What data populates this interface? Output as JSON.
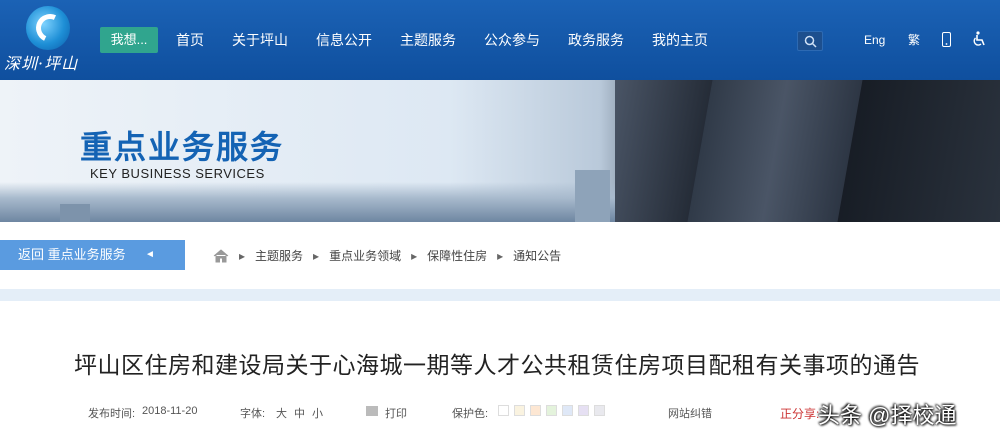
{
  "header": {
    "logo_text": "深圳·坪山",
    "wish_label": "我想...",
    "nav": [
      "首页",
      "关于坪山",
      "信息公开",
      "主题服务",
      "公众参与",
      "政务服务",
      "我的主页"
    ],
    "lang_label": "Eng",
    "traditional_label": "繁"
  },
  "banner": {
    "title": "重点业务服务",
    "subtitle": "KEY BUSINESS SERVICES"
  },
  "back_button": {
    "label": "返回 重点业务服务",
    "arrow": "◄"
  },
  "breadcrumb": {
    "items": [
      "主题服务",
      "重点业务领域",
      "保障性住房",
      "通知公告"
    ],
    "separator": "▸"
  },
  "article": {
    "title": "坪山区住房和建设局关于心海城一期等人才公共租赁住房项目配租有关事项的通告",
    "publish_label": "发布时间:",
    "publish_date": "2018-11-20",
    "font_label": "字体:",
    "font_sizes": [
      "大",
      "中",
      "小"
    ],
    "print_label": "打印",
    "eye_label": "保护色:",
    "eye_colors": [
      "#ffffff",
      "#faf3e0",
      "#fde7d3",
      "#e4f3dc",
      "#dfe8f7",
      "#e6e0f3",
      "#e9e9ee"
    ],
    "assistive_label": "网站纠错",
    "share_label": "正分享:"
  },
  "watermark": "头条 @择校通"
}
